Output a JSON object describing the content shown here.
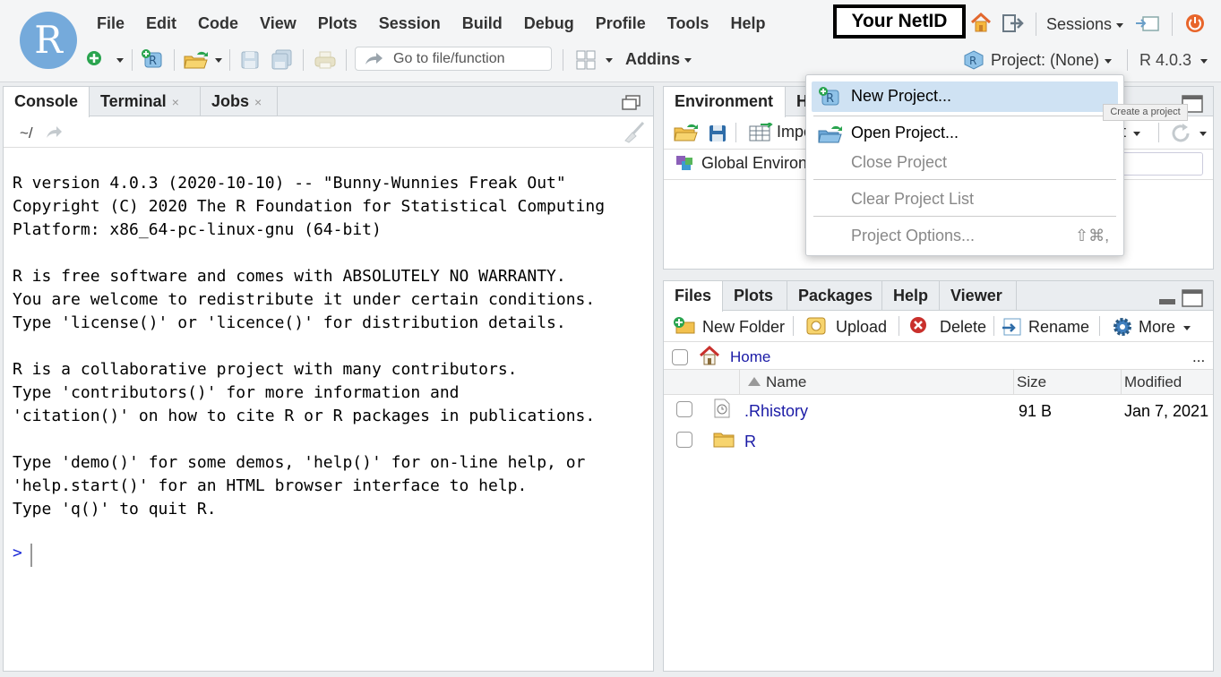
{
  "app": {
    "logo_letter": "R"
  },
  "menubar": [
    "File",
    "Edit",
    "Code",
    "View",
    "Plots",
    "Session",
    "Build",
    "Debug",
    "Profile",
    "Tools",
    "Help"
  ],
  "netid_label": "Your NetID",
  "sessions_label": "Sessions",
  "toolbar": {
    "goto_placeholder": "Go to file/function",
    "addins_label": "Addins",
    "project_label": "Project: (None)",
    "r_version": "R 4.0.3"
  },
  "console": {
    "tabs": [
      {
        "label": "Console",
        "close": ""
      },
      {
        "label": "Terminal",
        "close": "×"
      },
      {
        "label": "Jobs",
        "close": "×"
      }
    ],
    "path": "~/",
    "output": "R version 4.0.3 (2020-10-10) -- \"Bunny-Wunnies Freak Out\"\nCopyright (C) 2020 The R Foundation for Statistical Computing\nPlatform: x86_64-pc-linux-gnu (64-bit)\n\nR is free software and comes with ABSOLUTELY NO WARRANTY.\nYou are welcome to redistribute it under certain conditions.\nType 'license()' or 'licence()' for distribution details.\n\nR is a collaborative project with many contributors.\nType 'contributors()' for more information and\n'citation()' on how to cite R or R packages in publications.\n\nType 'demo()' for some demos, 'help()' for on-line help, or\n'help.start()' for an HTML browser interface to help.\nType 'q()' to quit R.",
    "prompt": ">"
  },
  "env": {
    "tabs": [
      "Environment",
      "H"
    ],
    "import_label": "Impo",
    "list_label": "st",
    "global_env": "Global Environ"
  },
  "files": {
    "tabs": [
      "Files",
      "Plots",
      "Packages",
      "Help",
      "Viewer"
    ],
    "actions": [
      "New Folder",
      "Upload",
      "Delete",
      "Rename",
      "More"
    ],
    "breadcrumb": "Home",
    "ellipsis": "...",
    "columns": {
      "name": "Name",
      "size": "Size",
      "modified": "Modified"
    },
    "rows": [
      {
        "name": ".Rhistory",
        "size": "91 B",
        "modified": "Jan 7, 2021"
      },
      {
        "name": "R",
        "size": "",
        "modified": ""
      }
    ]
  },
  "project_menu": {
    "items": [
      {
        "label": "New Project...",
        "disabled": false
      },
      {
        "label": "Open Project...",
        "disabled": false
      },
      {
        "label": "Close Project",
        "disabled": true
      },
      {
        "label": "Clear Project List",
        "disabled": true
      },
      {
        "label": "Project Options...",
        "disabled": true
      }
    ],
    "options_shortcut": "⇧⌘,",
    "tooltip": "Create a project"
  }
}
